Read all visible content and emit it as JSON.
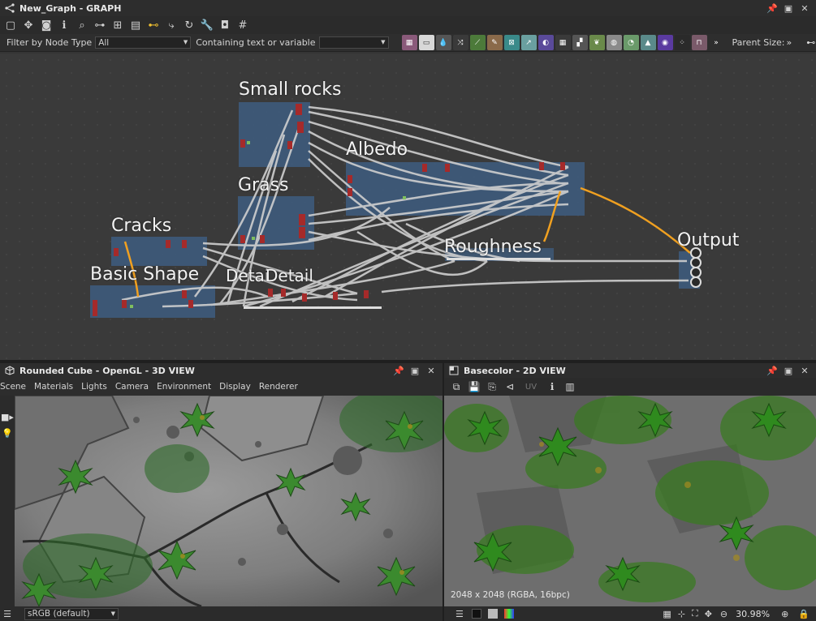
{
  "graph": {
    "title": "New_Graph - GRAPH",
    "filter_label": "Filter by Node Type",
    "filter_value": "All",
    "containing_label": "Containing text or variable",
    "parent_size_label": "Parent Size:",
    "frames": [
      "Small rocks",
      "Albedo",
      "Grass",
      "Cracks",
      "Basic Shape",
      "Detai",
      "Detail",
      "Roughness",
      "Output"
    ]
  },
  "view3d": {
    "title": "Rounded Cube - OpenGL - 3D VIEW",
    "menu": [
      "Scene",
      "Materials",
      "Lights",
      "Camera",
      "Environment",
      "Display",
      "Renderer"
    ],
    "colorspace": "sRGB (default)"
  },
  "view2d": {
    "title": "Basecolor - 2D VIEW",
    "uv_label": "UV",
    "resolution": "2048 x 2048 (RGBA, 16bpc)",
    "zoom": "30.98%"
  },
  "colors": {
    "frame_fill": "#3e5b7c",
    "link": "#cfcfcf",
    "link_highlight": "#f0a020",
    "node_red": "#a52a2a"
  }
}
